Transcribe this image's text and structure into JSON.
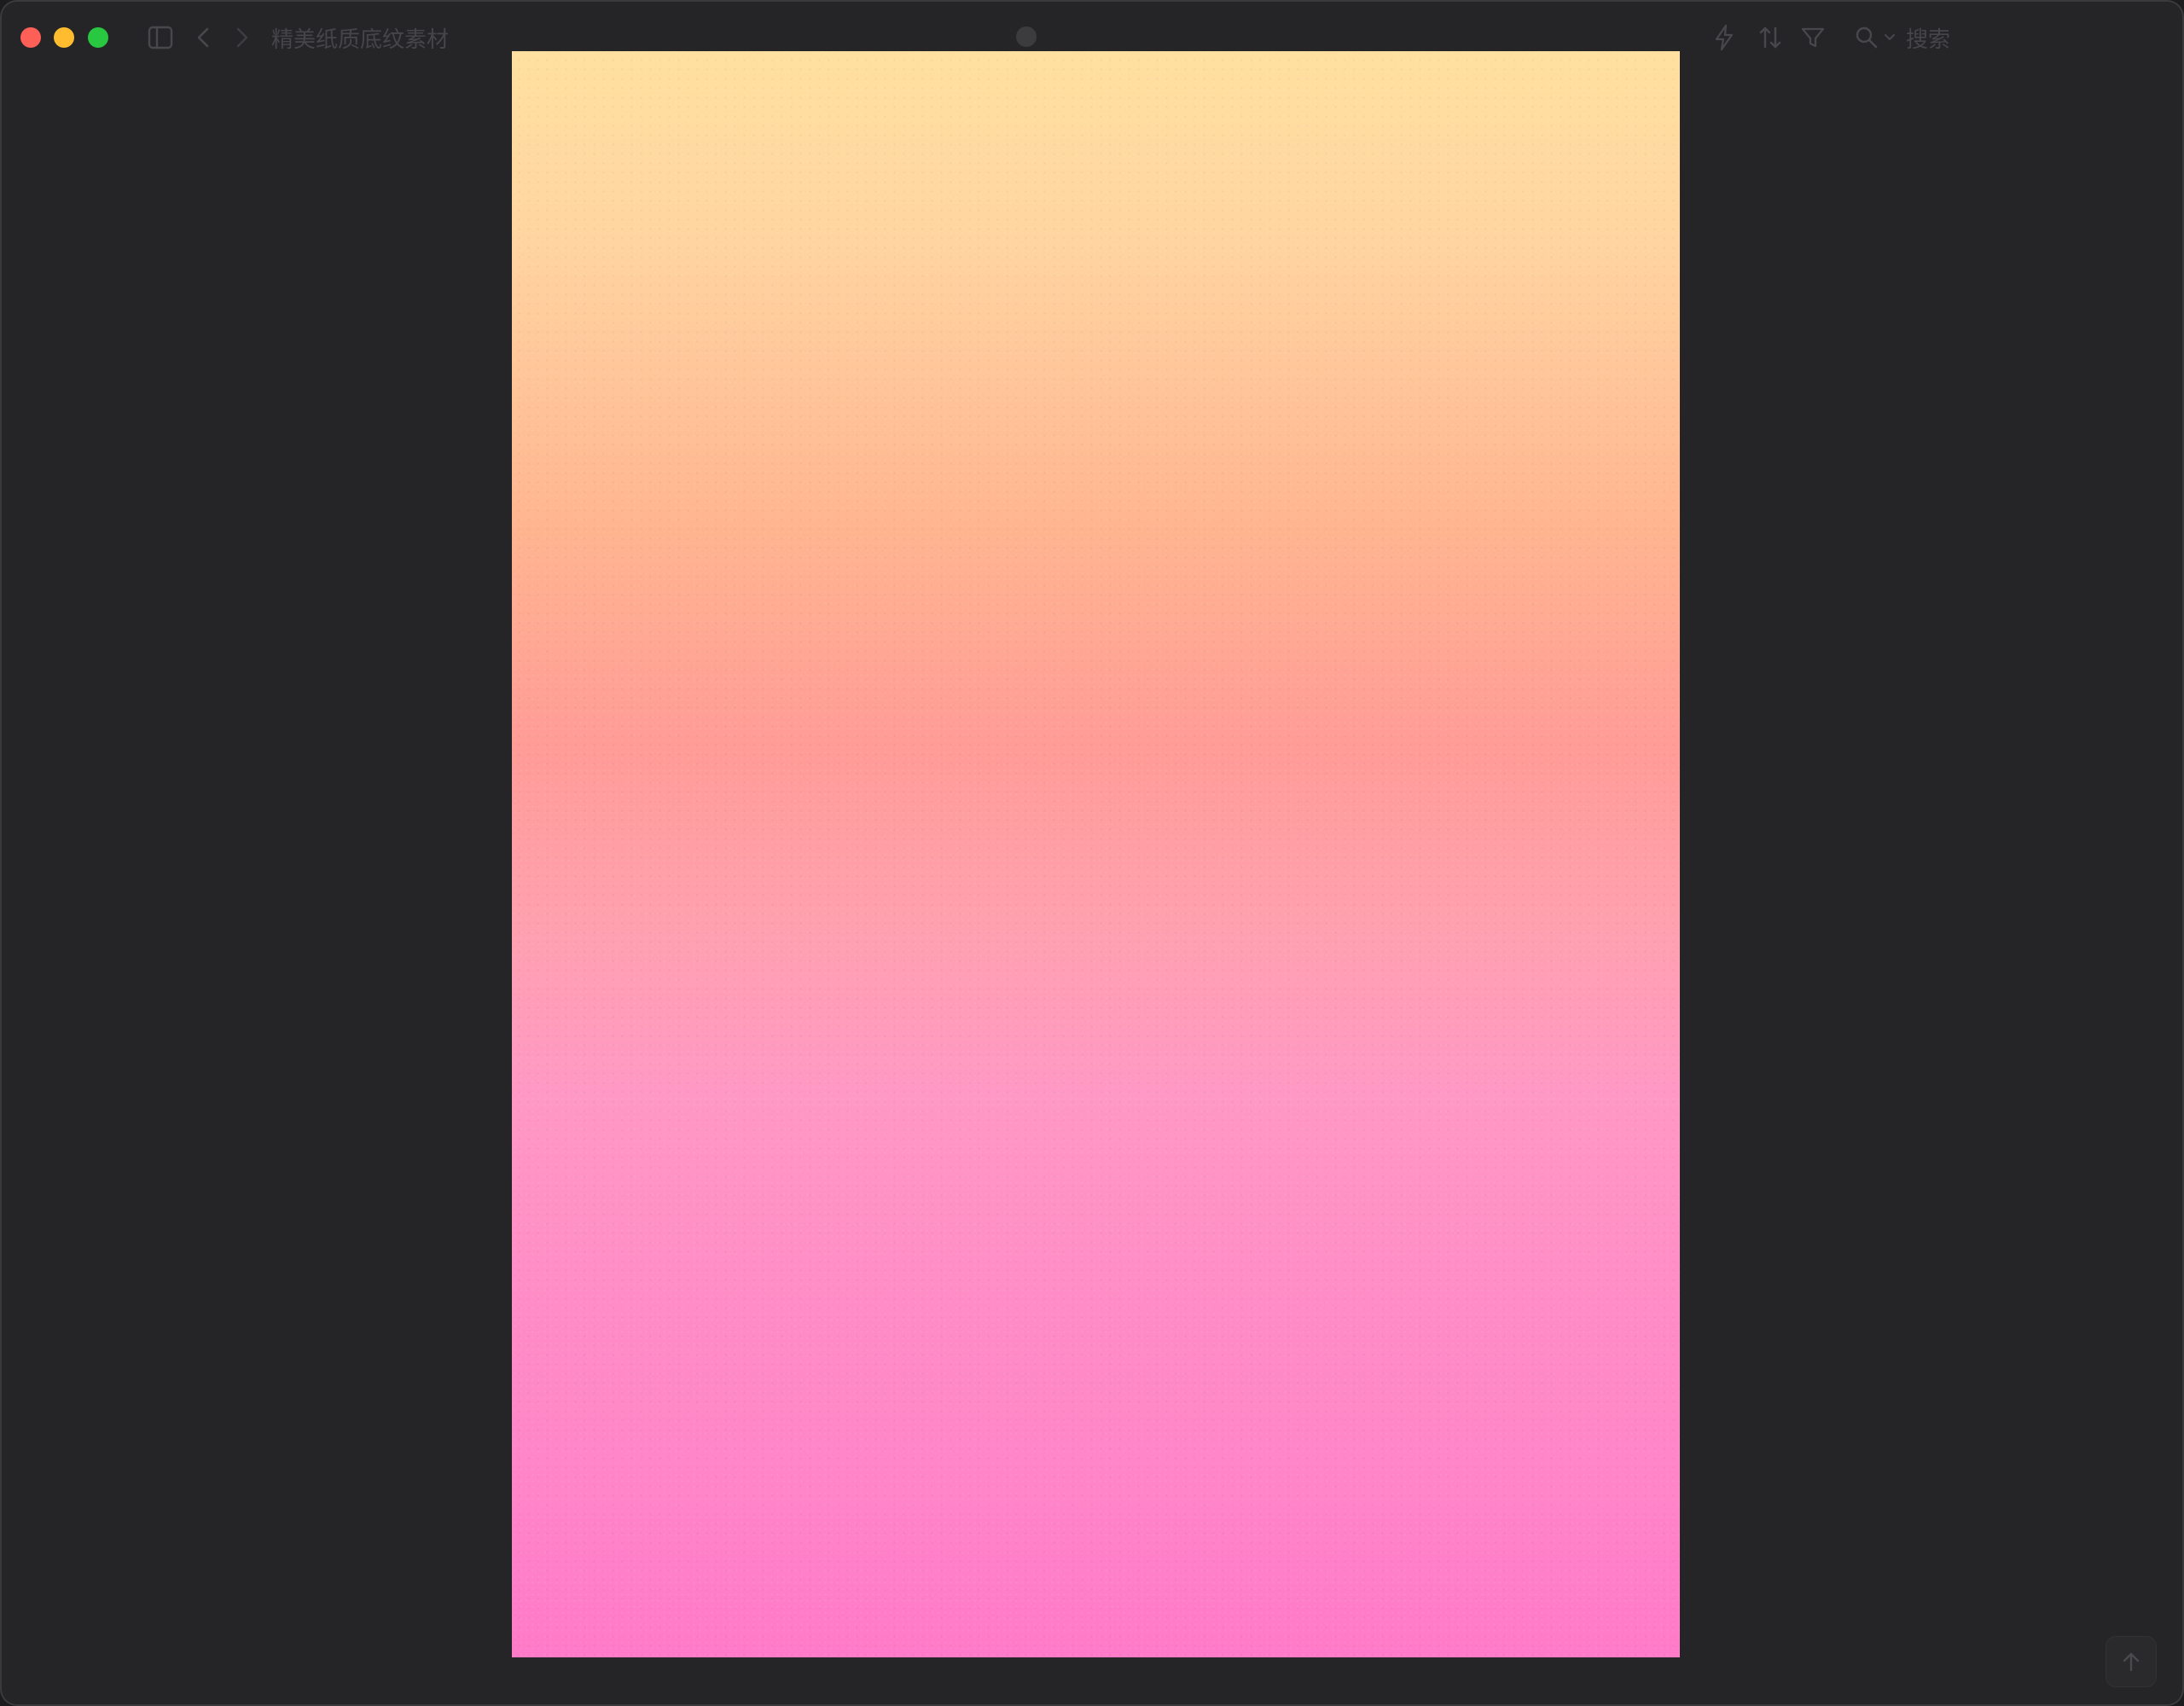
{
  "window": {
    "title": "精美纸质底纹素材",
    "background": "#252527"
  },
  "toolbar": {
    "search_label": "搜索",
    "icons": [
      "sidebar-toggle-icon",
      "chevron-left-icon",
      "chevron-right-icon",
      "lightning-icon",
      "sort-icon",
      "filter-icon",
      "search-icon",
      "chevron-down-icon"
    ]
  },
  "canvas": {
    "gradient_top": "#ffe0a0",
    "gradient_middle": "#ff9c96",
    "gradient_bottom": "#ff7ac8"
  },
  "footer": {
    "scroll_top_icon": "arrow-up-icon"
  }
}
